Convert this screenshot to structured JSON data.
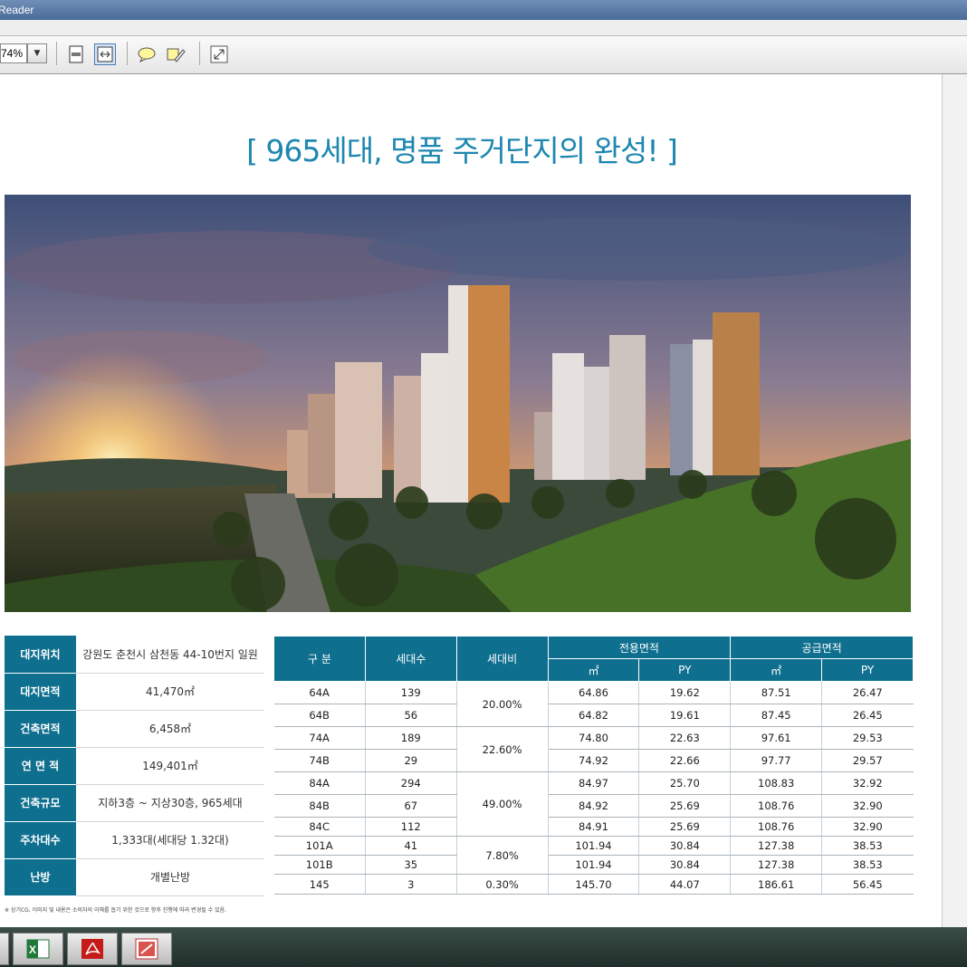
{
  "window": {
    "title": "Reader"
  },
  "toolbar": {
    "zoom_value": "74%"
  },
  "document": {
    "headline": "[ 965세대, 명품 주거단지의 완성! ]",
    "info_rows": [
      {
        "label": "대지위치",
        "value": "강원도 춘천시 삼천동 44-10번지 일원"
      },
      {
        "label": "대지면적",
        "value": "41,470㎡"
      },
      {
        "label": "건축면적",
        "value": "6,458㎡"
      },
      {
        "label": "연 면 적",
        "value": "149,401㎡"
      },
      {
        "label": "건축규모",
        "value": "지하3층 ~ 지상30층, 965세대"
      },
      {
        "label": "주차대수",
        "value": "1,333대(세대당 1.32대)"
      },
      {
        "label": "난방",
        "value": "개별난방"
      }
    ],
    "unit_headers": {
      "type": "구 분",
      "households": "세대수",
      "ratio": "세대비",
      "exclusive": "전용면적",
      "supply": "공급면적",
      "m2": "㎡",
      "py": "PY"
    },
    "units": [
      {
        "type": "64A",
        "households": "139",
        "ex_m2": "64.86",
        "ex_py": "19.62",
        "su_m2": "87.51",
        "su_py": "26.47"
      },
      {
        "type": "64B",
        "households": "56",
        "ex_m2": "64.82",
        "ex_py": "19.61",
        "su_m2": "87.45",
        "su_py": "26.45"
      },
      {
        "type": "74A",
        "households": "189",
        "ex_m2": "74.80",
        "ex_py": "22.63",
        "su_m2": "97.61",
        "su_py": "29.53"
      },
      {
        "type": "74B",
        "households": "29",
        "ex_m2": "74.92",
        "ex_py": "22.66",
        "su_m2": "97.77",
        "su_py": "29.57"
      },
      {
        "type": "84A",
        "households": "294",
        "ex_m2": "84.97",
        "ex_py": "25.70",
        "su_m2": "108.83",
        "su_py": "32.92"
      },
      {
        "type": "84B",
        "households": "67",
        "ex_m2": "84.92",
        "ex_py": "25.69",
        "su_m2": "108.76",
        "su_py": "32.90"
      },
      {
        "type": "84C",
        "households": "112",
        "ex_m2": "84.91",
        "ex_py": "25.69",
        "su_m2": "108.76",
        "su_py": "32.90"
      },
      {
        "type": "101A",
        "households": "41",
        "ex_m2": "101.94",
        "ex_py": "30.84",
        "su_m2": "127.38",
        "su_py": "38.53"
      },
      {
        "type": "101B",
        "households": "35",
        "ex_m2": "101.94",
        "ex_py": "30.84",
        "su_m2": "127.38",
        "su_py": "38.53"
      },
      {
        "type": "145",
        "households": "3",
        "ex_m2": "145.70",
        "ex_py": "44.07",
        "su_m2": "186.61",
        "su_py": "56.45"
      }
    ],
    "ratios": [
      "20.00%",
      "22.60%",
      "49.00%",
      "7.80%",
      "0.30%"
    ],
    "footnote": "※ 상기CG, 이미지 및 내용은 소비자의 이해를 돕기 위한 것으로 향후 진행에 따라 변경될 수 있음."
  },
  "taskbar": {
    "items": [
      "excel-icon",
      "acrobat-icon",
      "ppt-icon"
    ]
  }
}
